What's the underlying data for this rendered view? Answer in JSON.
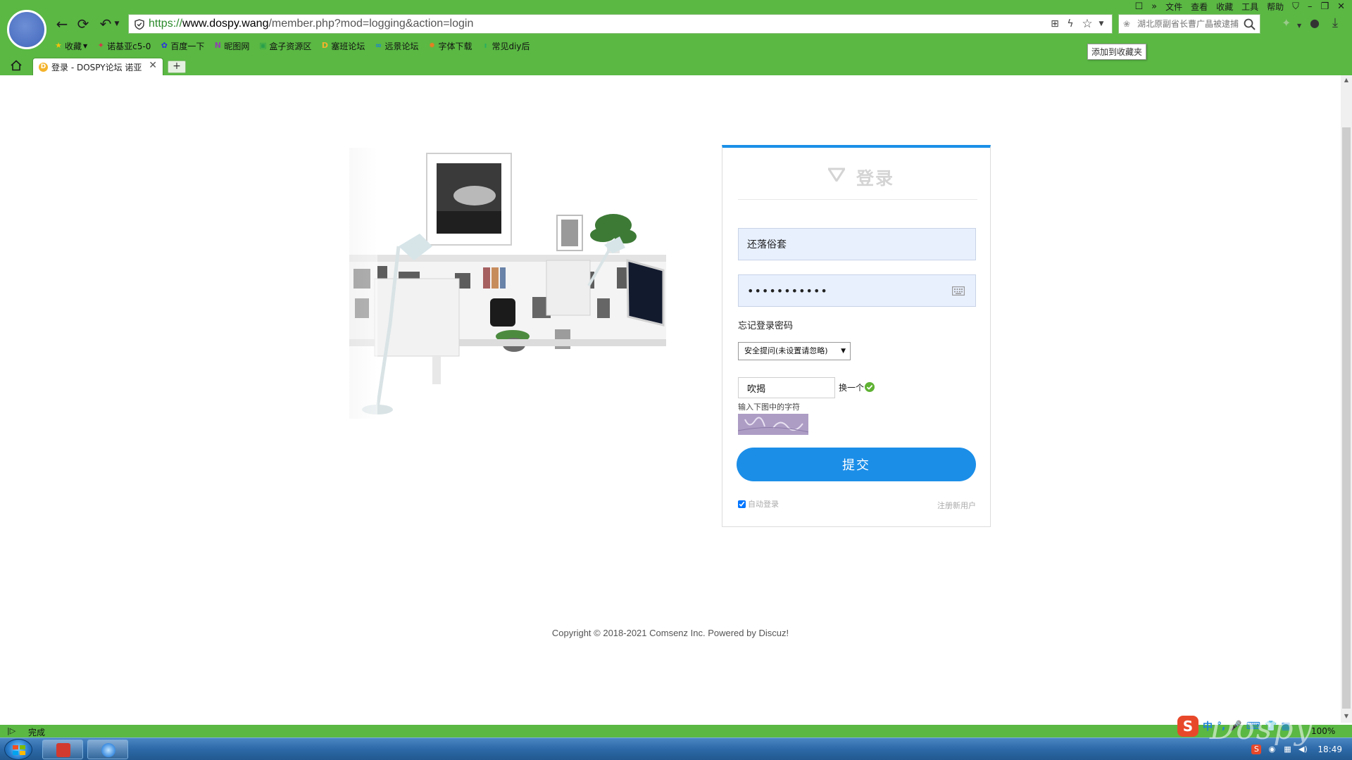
{
  "browser": {
    "url": {
      "scheme": "https://",
      "host": "www.dospy.wang",
      "path": "/member.php?mod=logging&action=login"
    },
    "search_placeholder": "湖北原副省长曹广晶被逮捕",
    "top_menu": [
      "文件",
      "查看",
      "收藏",
      "工具",
      "帮助"
    ],
    "bookmarks": [
      {
        "label": "收藏",
        "icon": "star-icon",
        "color": "#f4c20d"
      },
      {
        "label": "诺基亚c5-0",
        "icon": "nokia-icon",
        "color": "#d8334a"
      },
      {
        "label": "百度一下",
        "icon": "baidu-icon",
        "color": "#2932e1"
      },
      {
        "label": "昵图网",
        "icon": "nipic-icon",
        "color": "#8e44ad"
      },
      {
        "label": "盒子资源区",
        "icon": "box-icon",
        "color": "#2aa14b"
      },
      {
        "label": "塞班论坛",
        "icon": "dospy-icon",
        "color": "#f4b32c"
      },
      {
        "label": "远景论坛",
        "icon": "pcbeta-icon",
        "color": "#1c7ed6"
      },
      {
        "label": "字体下载",
        "icon": "font-icon",
        "color": "#e67e22"
      },
      {
        "label": "常见diy后",
        "icon": "diy-icon",
        "color": "#27ae60"
      }
    ],
    "tooltip": "添加到收藏夹",
    "tab_title": "登录 - DOSPY论坛 诺亚",
    "new_tab_label": "+",
    "status_text": "完成",
    "zoom": "100%",
    "clock": "18:49",
    "watermark": "Dospy",
    "ime_items": [
      "中",
      "°,",
      "🎤",
      "⌨",
      "👕",
      "▦"
    ],
    "colors": {
      "chrome_green": "#5ab843",
      "accent_blue": "#1b8ee8"
    }
  },
  "login": {
    "title": "登录",
    "username": "还落俗套",
    "password_masked": "•••••••••••",
    "forgot_password": "忘记登录密码",
    "security_question": "安全提问(未设置请忽略)",
    "captcha_value": "吹揭",
    "captcha_refresh": "换一个",
    "captcha_hint": "输入下图中的字符",
    "submit": "提交",
    "auto_login": "自动登录",
    "auto_login_checked": true,
    "register": "注册新用户"
  },
  "footer": {
    "copyright": "Copyright © 2018-2021 Comsenz Inc. Powered by Discuz!"
  }
}
